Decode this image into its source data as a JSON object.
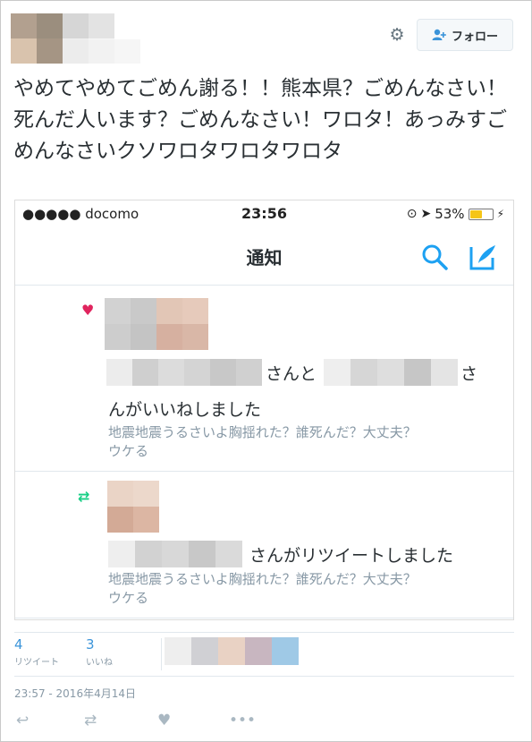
{
  "header": {
    "follow_label": "フォロー",
    "settings_icon": "gear-icon",
    "follow_icon": "person-add-icon"
  },
  "tweet": {
    "text": "やめてやめてごめん謝る！！熊本県？ごめんなさい！死んだ人います？ごめんなさい！ワロタ！あっみすごめんなさいクソワロタワロタワロタ",
    "timestamp": "23:57 - 2016年4月14日"
  },
  "screenshot": {
    "status_bar": {
      "carrier": "●●●●● docomo",
      "time": "23:56",
      "battery_percent": "53%",
      "battery_level": 0.53
    },
    "nav_title": "通知",
    "notifications": [
      {
        "type": "like",
        "icon": "heart-icon",
        "line_mid": "さんと",
        "line_end": "さ",
        "line2": "んがいいねしました",
        "quote_line1": "地震地震うるさいよ胸揺れた？誰死んだ？大丈夫？",
        "quote_line2": "ウケる"
      },
      {
        "type": "retweet",
        "icon": "retweet-icon",
        "line_end": "さんがリツイートしました",
        "quote_line1": "地震地震うるさいよ胸揺れた？誰死んだ？大丈夫？",
        "quote_line2": "ウケる"
      }
    ]
  },
  "stats": {
    "retweets_count": "4",
    "retweets_label": "リツイート",
    "likes_count": "3",
    "likes_label": "いいね"
  },
  "colors": {
    "accent": "#3b94d9",
    "like": "#e0245e",
    "retweet": "#19cf86",
    "text": "#292f33",
    "muted": "#8899a6"
  }
}
